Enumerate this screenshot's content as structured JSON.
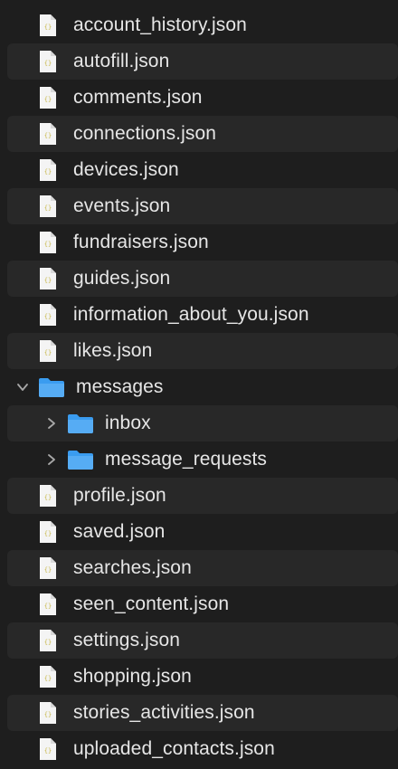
{
  "files_top": [
    {
      "name": "account_history.json"
    },
    {
      "name": "autofill.json"
    },
    {
      "name": "comments.json"
    },
    {
      "name": "connections.json"
    },
    {
      "name": "devices.json"
    },
    {
      "name": "events.json"
    },
    {
      "name": "fundraisers.json"
    },
    {
      "name": "guides.json"
    },
    {
      "name": "information_about_you.json"
    },
    {
      "name": "likes.json"
    }
  ],
  "folder": {
    "name": "messages",
    "expanded": true,
    "icon": "folder-icon",
    "children": [
      {
        "name": "inbox",
        "expanded": false,
        "icon": "folder-icon"
      },
      {
        "name": "message_requests",
        "expanded": false,
        "icon": "folder-icon"
      }
    ]
  },
  "files_bottom": [
    {
      "name": "profile.json"
    },
    {
      "name": "saved.json"
    },
    {
      "name": "searches.json"
    },
    {
      "name": "seen_content.json"
    },
    {
      "name": "settings.json"
    },
    {
      "name": "shopping.json"
    },
    {
      "name": "stories_activities.json"
    },
    {
      "name": "uploaded_contacts.json"
    }
  ],
  "colors": {
    "background": "#1e1e1e",
    "row_alternate": "#282828",
    "text": "#e6e6e6",
    "folder": "#3a9cf0",
    "json_icon_accent": "#c8b84a"
  }
}
